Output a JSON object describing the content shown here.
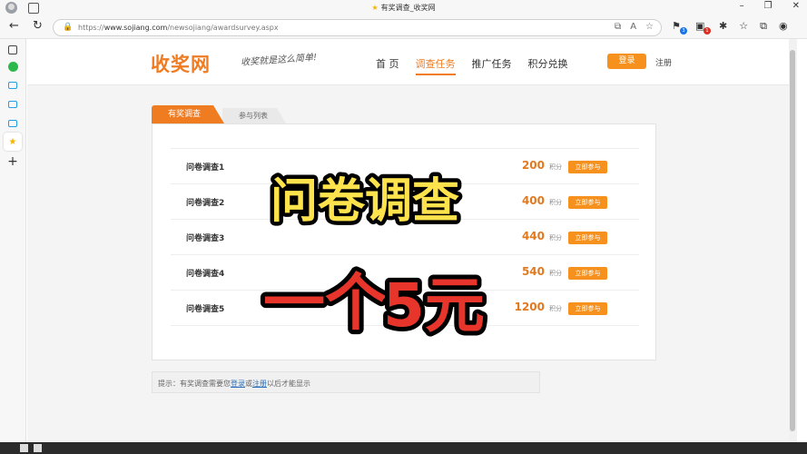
{
  "browser": {
    "tab_title": "有奖调查_收奖网",
    "url_prefix": "https://",
    "url_host": "www.sojiang.com",
    "url_path": "/newsojiang/awardsurvey.aspx"
  },
  "site": {
    "logo": "收奖网",
    "slogan": "收奖就是这么简单!",
    "nav": [
      "首 页",
      "调查任务",
      "推广任务",
      "积分兑换"
    ],
    "login": "登录",
    "register": "注册"
  },
  "tabs": {
    "active": "有奖调查",
    "inactive": "参与列表"
  },
  "surveys": [
    {
      "name": "问卷调查1",
      "points": "200",
      "unit": "积分",
      "button": "立即参与"
    },
    {
      "name": "问卷调查2",
      "points": "400",
      "unit": "积分",
      "button": "立即参与"
    },
    {
      "name": "问卷调查3",
      "points": "440",
      "unit": "积分",
      "button": "立即参与"
    },
    {
      "name": "问卷调查4",
      "points": "540",
      "unit": "积分",
      "button": "立即参与"
    },
    {
      "name": "问卷调查5",
      "points": "1200",
      "unit": "积分",
      "button": "立即参与"
    }
  ],
  "tip": {
    "prefix": "提示：有奖调查需要您",
    "login_link": "登录",
    "or": "或",
    "register_link": "注册",
    "suffix": "以后才能显示"
  },
  "overlay": {
    "line1": "问卷调查",
    "line2_part1": "一个",
    "line2_part2": "5元"
  },
  "colors": {
    "brand_orange": "#f07c22",
    "button_orange": "#f5911c",
    "overlay_yellow": "#ffe34d",
    "overlay_red": "#e8352b"
  },
  "icons": {
    "back": "arrow-left-icon",
    "refresh": "refresh-icon",
    "lock": "lock-icon",
    "favorite": "star-icon"
  }
}
